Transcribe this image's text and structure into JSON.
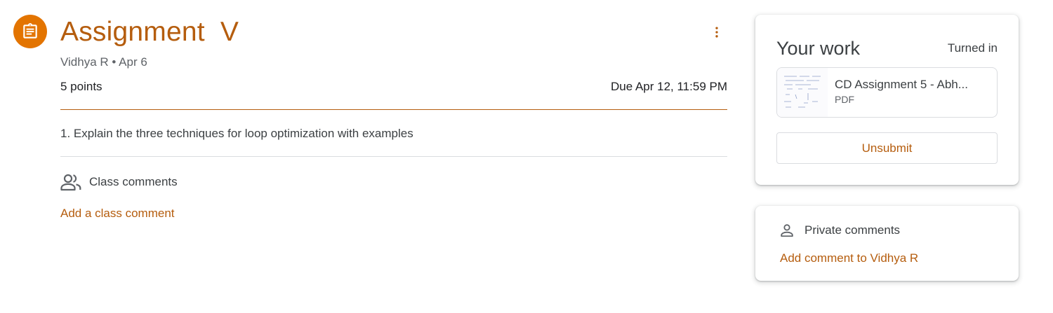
{
  "assignment": {
    "title": "Assignment  V",
    "author": "Vidhya R",
    "separator": "•",
    "posted_date": "Apr 6",
    "points": "5 points",
    "due": "Due Apr 12, 11:59 PM",
    "instructions": "1. Explain the three techniques for loop optimization with examples",
    "icon": "assignment-clipboard-icon",
    "menu_icon": "more-vert-icon"
  },
  "class_comments": {
    "label": "Class comments",
    "add_label": "Add a class comment",
    "icon": "people-icon"
  },
  "your_work": {
    "title": "Your work",
    "status": "Turned in",
    "attachment": {
      "name": "CD Assignment 5 - Abh...",
      "type": "PDF"
    },
    "unsubmit_label": "Unsubmit"
  },
  "private_comments": {
    "label": "Private comments",
    "add_label": "Add comment to Vidhya R",
    "icon": "person-icon"
  },
  "colors": {
    "accent": "#b55d0e",
    "icon_bg": "#e37400"
  }
}
